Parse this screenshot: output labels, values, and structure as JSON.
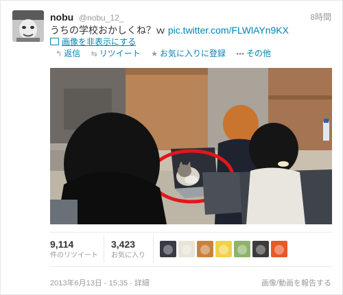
{
  "tweet": {
    "name": "nobu",
    "handle": "@nobu_12_",
    "time": "8時間",
    "text": "うちの学校おかしくね？ｗ ",
    "link": "pic.twitter.com/FLWlAYn9KX",
    "hide_media": "画像を非表示にする"
  },
  "actions": {
    "reply": "返信",
    "retweet": "リツイート",
    "favorite": "お気に入りに登録",
    "more": "その他"
  },
  "stats": {
    "retweets": "9,114",
    "retweets_label": "件のリツイート",
    "favorites": "3,423",
    "favorites_label": "お気に入り"
  },
  "favoriters": [
    {
      "icon": "avatar-icon",
      "color": "#3a3a44"
    },
    {
      "icon": "avatar-icon",
      "color": "#e9e4d8"
    },
    {
      "icon": "avatar-icon",
      "color": "#c9823c"
    },
    {
      "icon": "avatar-icon",
      "color": "#f0d24a"
    },
    {
      "icon": "avatar-icon",
      "color": "#8fb36a"
    },
    {
      "icon": "avatar-icon",
      "color": "#3b3b3b"
    },
    {
      "icon": "avatar-icon",
      "color": "#e65a2a"
    }
  ],
  "footer": {
    "date": "2013年6月13日 - 15:35 · 詳細",
    "report": "画像/動画を報告する"
  },
  "colors": {
    "link": "#0084b4",
    "muted": "#999999",
    "highlight_circle": "#e0171c"
  }
}
